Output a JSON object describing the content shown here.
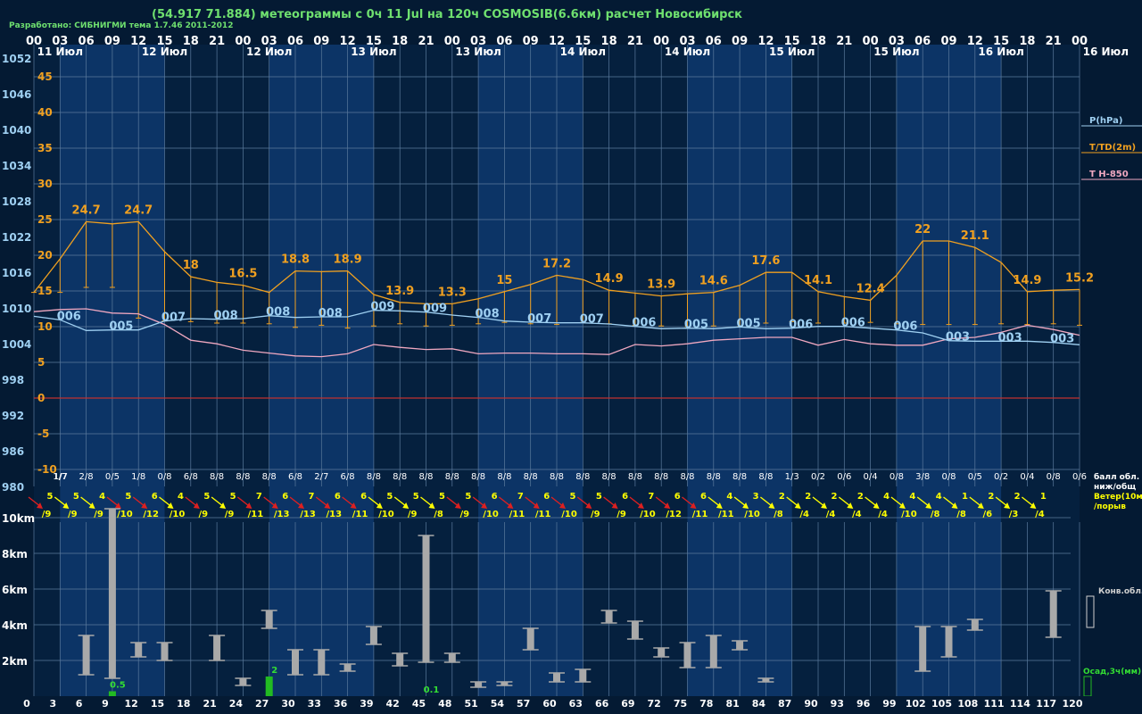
{
  "header": {
    "title": "(54.917 71.884) метеограммы с  0ч 11 Jul на 120ч COSMOSIB(6.6км) расчет Новосибирск",
    "credit": "Разработано: СИБНИГМИ тема 1.7.46 2011-2012"
  },
  "colors": {
    "background": "#041a33",
    "band_dark": "#05203e",
    "band_light": "#0c3466",
    "grid": "#5b7a9c",
    "pressure": "#9fd0f2",
    "temperature": "#f0a020",
    "t850": "#f0a8c0",
    "zero_line": "#c03030",
    "wind_yellow": "#ffff00",
    "wind_red": "#dd2020",
    "cloud_bar": "#a9a9a9",
    "precip_bar": "#22bb22",
    "precip_label": "#33dd33"
  },
  "chart_data": {
    "type": "line",
    "x_hours": [
      0,
      3,
      6,
      9,
      12,
      15,
      18,
      21,
      24,
      27,
      30,
      33,
      36,
      39,
      42,
      45,
      48,
      51,
      54,
      57,
      60,
      63,
      66,
      69,
      72,
      75,
      78,
      81,
      84,
      87,
      90,
      93,
      96,
      99,
      102,
      105,
      108,
      111,
      114,
      117,
      120
    ],
    "top_hour_ticks": [
      "00",
      "03",
      "06",
      "09",
      "12",
      "15",
      "18",
      "21",
      "00",
      "03",
      "06",
      "09",
      "12",
      "15",
      "18",
      "21",
      "00",
      "03",
      "06",
      "09",
      "12",
      "15",
      "18",
      "21",
      "00",
      "03",
      "06",
      "09",
      "12",
      "15",
      "18",
      "21",
      "00",
      "03",
      "06",
      "09",
      "12",
      "15",
      "18",
      "21",
      "00"
    ],
    "date_labels": [
      {
        "hour": 3,
        "text": "11 Июл"
      },
      {
        "hour": 15,
        "text": "12 Июл"
      },
      {
        "hour": 27,
        "text": "12 Июл"
      },
      {
        "hour": 39,
        "text": "13 Июл"
      },
      {
        "hour": 51,
        "text": "13 Июл"
      },
      {
        "hour": 63,
        "text": "14 Июл"
      },
      {
        "hour": 75,
        "text": "14 Июл"
      },
      {
        "hour": 87,
        "text": "15 Июл"
      },
      {
        "hour": 99,
        "text": "15 Июл"
      },
      {
        "hour": 111,
        "text": "16 Июл"
      },
      {
        "hour": 123,
        "text": "16 Июл"
      }
    ],
    "pressure_axis": {
      "label": "P(hPa)",
      "ticks": [
        1052,
        1046,
        1040,
        1034,
        1028,
        1022,
        1016,
        1010,
        1004,
        998,
        992,
        986,
        980
      ],
      "range": [
        980,
        1052
      ]
    },
    "temperature_axis": {
      "label": "T/TD(2m)",
      "ticks": [
        45,
        40,
        35,
        30,
        25,
        20,
        15,
        10,
        5,
        0,
        -5,
        -10
      ],
      "range": [
        -10,
        45
      ]
    },
    "t850_label": "T H-850",
    "series": [
      {
        "name": "T/TD(2m)",
        "axis": "temperature",
        "values": [
          14.8,
          19.5,
          24.7,
          24.4,
          24.7,
          20.5,
          17.0,
          16.2,
          15.8,
          14.8,
          17.8,
          17.7,
          17.8,
          14.5,
          13.4,
          13.2,
          13.2,
          13.9,
          14.9,
          15.9,
          17.2,
          16.6,
          15.1,
          14.7,
          14.3,
          14.6,
          14.8,
          15.8,
          17.6,
          17.6,
          14.9,
          14.2,
          13.7,
          17.2,
          22.0,
          22.0,
          21.1,
          19.0,
          14.9,
          15.1,
          15.2
        ],
        "labels": [
          {
            "hour": 6,
            "text": "24.7"
          },
          {
            "hour": 12,
            "text": "24.7"
          },
          {
            "hour": 18,
            "text": "18"
          },
          {
            "hour": 24,
            "text": "16.5"
          },
          {
            "hour": 30,
            "text": "18.8"
          },
          {
            "hour": 36,
            "text": "18.9"
          },
          {
            "hour": 42,
            "text": "13.9"
          },
          {
            "hour": 48,
            "text": "13.3"
          },
          {
            "hour": 54,
            "text": "15"
          },
          {
            "hour": 60,
            "text": "17.2"
          },
          {
            "hour": 66,
            "text": "14.9"
          },
          {
            "hour": 72,
            "text": "13.9"
          },
          {
            "hour": 78,
            "text": "14.6"
          },
          {
            "hour": 84,
            "text": "17.6"
          },
          {
            "hour": 90,
            "text": "14.1"
          },
          {
            "hour": 96,
            "text": "12.4"
          },
          {
            "hour": 102,
            "text": "22"
          },
          {
            "hour": 108,
            "text": "21.1"
          },
          {
            "hour": 114,
            "text": "14.9"
          },
          {
            "hour": 120,
            "text": "15.2"
          }
        ]
      },
      {
        "name": "dew point",
        "axis": "temperature",
        "values": [
          14.8,
          14.8,
          15.5,
          15.5,
          11.2,
          10.8,
          10.7,
          10.5,
          10.5,
          10.4,
          9.9,
          10.2,
          9.8,
          10.1,
          10.4,
          10.1,
          10.2,
          10.4,
          10.6,
          10.4,
          10.3,
          10.6,
          10.4,
          10.2,
          10.1,
          10.0,
          10.1,
          10.0,
          10.5,
          10.7,
          10.5,
          10.5,
          10.6,
          10.4,
          10.3,
          10.3,
          10.3,
          10.4,
          10.3,
          10.4,
          10.2
        ]
      },
      {
        "name": "P(hPa)",
        "axis": "pressure",
        "values": [
          1008.6,
          1008.0,
          1006.2,
          1006.3,
          1006.3,
          1007.8,
          1008.2,
          1008.1,
          1008.2,
          1008.7,
          1008.4,
          1008.5,
          1008.5,
          1009.6,
          1009.5,
          1009.3,
          1008.8,
          1008.4,
          1007.8,
          1007.6,
          1007.5,
          1007.5,
          1007.3,
          1006.9,
          1006.5,
          1006.6,
          1006.5,
          1006.8,
          1006.5,
          1006.6,
          1006.9,
          1006.9,
          1006.6,
          1006.3,
          1005.8,
          1004.5,
          1004.4,
          1004.4,
          1004.4,
          1004.2,
          1003.8
        ],
        "labels": [
          {
            "hour": 3,
            "text": "006"
          },
          {
            "hour": 9,
            "text": "005"
          },
          {
            "hour": 15,
            "text": "007"
          },
          {
            "hour": 21,
            "text": "008"
          },
          {
            "hour": 27,
            "text": "008"
          },
          {
            "hour": 33,
            "text": "008"
          },
          {
            "hour": 39,
            "text": "009"
          },
          {
            "hour": 45,
            "text": "009"
          },
          {
            "hour": 51,
            "text": "008"
          },
          {
            "hour": 57,
            "text": "007"
          },
          {
            "hour": 63,
            "text": "007"
          },
          {
            "hour": 69,
            "text": "006"
          },
          {
            "hour": 75,
            "text": "005"
          },
          {
            "hour": 81,
            "text": "005"
          },
          {
            "hour": 87,
            "text": "006"
          },
          {
            "hour": 93,
            "text": "006"
          },
          {
            "hour": 99,
            "text": "006"
          },
          {
            "hour": 105,
            "text": "003"
          },
          {
            "hour": 111,
            "text": "003"
          },
          {
            "hour": 117,
            "text": "003"
          }
        ]
      },
      {
        "name": "T H-850",
        "axis": "temperature",
        "values": [
          12.1,
          12.4,
          12.5,
          11.9,
          11.8,
          10.3,
          8.1,
          7.6,
          6.7,
          6.3,
          5.9,
          5.8,
          6.2,
          7.5,
          7.1,
          6.8,
          6.9,
          6.2,
          6.3,
          6.3,
          6.2,
          6.2,
          6.1,
          7.5,
          7.3,
          7.6,
          8.1,
          8.3,
          8.5,
          8.5,
          7.4,
          8.2,
          7.6,
          7.4,
          7.4,
          8.3,
          8.5,
          9.2,
          10.2,
          9.6,
          8.8
        ]
      }
    ],
    "cloud_cover": {
      "label": "балл обл. ниж/общ",
      "values": [
        "1/7",
        "1/7",
        "2/8",
        "0/5",
        "1/8",
        "0/8",
        "6/8",
        "8/8",
        "8/8",
        "8/8",
        "6/8",
        "2/7",
        "6/8",
        "8/8",
        "8/8",
        "8/8",
        "8/8",
        "8/8",
        "8/8",
        "8/8",
        "8/8",
        "8/8",
        "8/8",
        "8/8",
        "8/8",
        "8/8",
        "8/8",
        "8/8",
        "8/8",
        "1/3",
        "0/2",
        "0/6",
        "0/4",
        "0/8",
        "3/8",
        "0/8",
        "0/5",
        "0/2",
        "0/4",
        "0/8",
        "0/6"
      ]
    },
    "wind": {
      "label": "Ветер(10м) /порыв",
      "speed": [
        5,
        5,
        4,
        5,
        6,
        4,
        5,
        5,
        7,
        6,
        7,
        6,
        6,
        5,
        5,
        5,
        5,
        6,
        7,
        6,
        5,
        5,
        6,
        7,
        6,
        6,
        4,
        3,
        2,
        2,
        2,
        2,
        4,
        4,
        4,
        1,
        2,
        2,
        1
      ],
      "gust": [
        "/9",
        "/9",
        "/9",
        "/10",
        "/12",
        "/10",
        "/9",
        "/9",
        "/11",
        "/13",
        "/13",
        "/13",
        "/11",
        "/10",
        "/9",
        "/8",
        "/9",
        "/10",
        "/11",
        "/11",
        "/10",
        "/9",
        "/9",
        "/10",
        "/12",
        "/11",
        "/11",
        "/10",
        "/8",
        "/4",
        "/4",
        "/4",
        "/4",
        "/10",
        "/8",
        "/8",
        "/6",
        "/3",
        "/4",
        "/4"
      ],
      "color": [
        "r",
        "y",
        "y",
        "r",
        "r",
        "y",
        "r",
        "y",
        "r",
        "r",
        "r",
        "r",
        "r",
        "y",
        "y",
        "y",
        "r",
        "r",
        "r",
        "r",
        "r",
        "r",
        "r",
        "r",
        "r",
        "r",
        "y",
        "y",
        "y",
        "y",
        "y",
        "y",
        "y",
        "y",
        "y",
        "y",
        "y",
        "y",
        "y",
        "y"
      ]
    },
    "cloud_layers": {
      "label": "Конв.обл.",
      "axis_ticks": [
        "10km",
        "8km",
        "6km",
        "4km",
        "2km"
      ],
      "range_km": [
        0,
        10.5
      ],
      "bars": [
        {
          "hour": 6,
          "bottom": 1.2,
          "top": 3.4
        },
        {
          "hour": 9,
          "bottom": 1.0,
          "top": 10.5
        },
        {
          "hour": 12,
          "bottom": 2.2,
          "top": 3.0
        },
        {
          "hour": 15,
          "bottom": 2.0,
          "top": 3.0
        },
        {
          "hour": 21,
          "bottom": 2.0,
          "top": 3.4
        },
        {
          "hour": 24,
          "bottom": 0.6,
          "top": 1.0
        },
        {
          "hour": 27,
          "bottom": 3.8,
          "top": 4.8
        },
        {
          "hour": 30,
          "bottom": 1.2,
          "top": 2.6
        },
        {
          "hour": 33,
          "bottom": 1.2,
          "top": 2.6
        },
        {
          "hour": 36,
          "bottom": 1.4,
          "top": 1.8
        },
        {
          "hour": 39,
          "bottom": 2.9,
          "top": 3.9
        },
        {
          "hour": 42,
          "bottom": 1.7,
          "top": 2.4
        },
        {
          "hour": 45,
          "bottom": 1.9,
          "top": 9.0
        },
        {
          "hour": 48,
          "bottom": 1.9,
          "top": 2.4
        },
        {
          "hour": 51,
          "bottom": 0.5,
          "top": 0.8
        },
        {
          "hour": 54,
          "bottom": 0.6,
          "top": 0.8
        },
        {
          "hour": 57,
          "bottom": 2.6,
          "top": 3.8
        },
        {
          "hour": 60,
          "bottom": 0.8,
          "top": 1.3
        },
        {
          "hour": 63,
          "bottom": 0.8,
          "top": 1.5
        },
        {
          "hour": 66,
          "bottom": 4.1,
          "top": 4.8
        },
        {
          "hour": 69,
          "bottom": 3.2,
          "top": 4.2
        },
        {
          "hour": 72,
          "bottom": 2.2,
          "top": 2.7
        },
        {
          "hour": 75,
          "bottom": 1.6,
          "top": 3.0
        },
        {
          "hour": 78,
          "bottom": 1.6,
          "top": 3.4
        },
        {
          "hour": 81,
          "bottom": 2.6,
          "top": 3.1
        },
        {
          "hour": 84,
          "bottom": 0.8,
          "top": 1.0
        },
        {
          "hour": 102,
          "bottom": 1.4,
          "top": 3.9
        },
        {
          "hour": 105,
          "bottom": 2.2,
          "top": 3.9
        },
        {
          "hour": 108,
          "bottom": 3.7,
          "top": 4.3
        },
        {
          "hour": 117,
          "bottom": 3.3,
          "top": 5.9
        }
      ]
    },
    "precipitation": {
      "label": "Осад,3ч(мм)",
      "bars": [
        {
          "hour": 9,
          "value": 0.5,
          "text": "0.5"
        },
        {
          "hour": 27,
          "value": 2,
          "text": "2"
        },
        {
          "hour": 45,
          "value": 0,
          "text": "0.1"
        }
      ]
    },
    "bottom_hour_ticks": [
      "0",
      "3",
      "6",
      "9",
      "12",
      "15",
      "18",
      "21",
      "24",
      "27",
      "30",
      "33",
      "36",
      "39",
      "42",
      "45",
      "48",
      "51",
      "54",
      "57",
      "60",
      "63",
      "66",
      "69",
      "72",
      "75",
      "78",
      "81",
      "84",
      "87",
      "90",
      "93",
      "96",
      "99",
      "102",
      "105",
      "108",
      "111",
      "114",
      "117",
      "120"
    ]
  }
}
